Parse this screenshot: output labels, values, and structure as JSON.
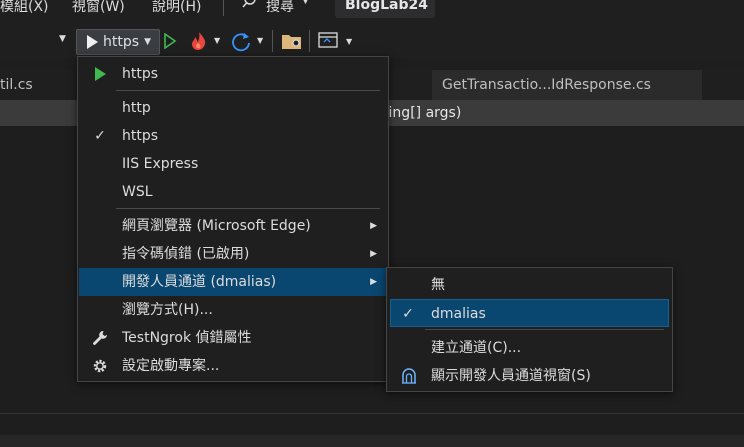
{
  "menubar": {
    "items": [
      "模組(X)",
      "視窗(W)",
      "說明(H)",
      "搜尋"
    ],
    "title": "BlogLab24"
  },
  "toolbar": {
    "run_label": "https"
  },
  "tabs": [
    {
      "label": "til.cs"
    },
    {
      "label": "GetTransactio...IdResponse.cs"
    }
  ],
  "navbar": {
    "text": "string[] args)"
  },
  "launch_menu": {
    "header": "https",
    "profiles": [
      {
        "label": "http",
        "checked": false
      },
      {
        "label": "https",
        "checked": true
      },
      {
        "label": "IIS Express",
        "checked": false
      },
      {
        "label": "WSL",
        "checked": false
      }
    ],
    "items": [
      {
        "label": "網頁瀏覽器 (Microsoft Edge)",
        "submenu": true
      },
      {
        "label": "指令碼偵錯 (已啟用)",
        "submenu": true
      },
      {
        "label": "開發人員通道 (dmalias)",
        "submenu": true,
        "highlighted": true
      },
      {
        "label": "瀏覽方式(H)...",
        "submenu": false
      },
      {
        "label": "TestNgrok 偵錯屬性",
        "submenu": false
      },
      {
        "label": "設定啟動專案...",
        "submenu": false
      }
    ]
  },
  "tunnel_menu": {
    "items": [
      {
        "label": "無",
        "checked": false
      },
      {
        "label": "dmalias",
        "checked": true
      },
      {
        "label": "建立通道(C)...",
        "checked": false
      },
      {
        "label": "顯示開發人員通道視窗(S)",
        "checked": false
      }
    ]
  },
  "colors": {
    "highlight": "#094771",
    "play_green": "#3fb950",
    "flame": "#e8453c",
    "refresh_blue": "#3794ff"
  }
}
